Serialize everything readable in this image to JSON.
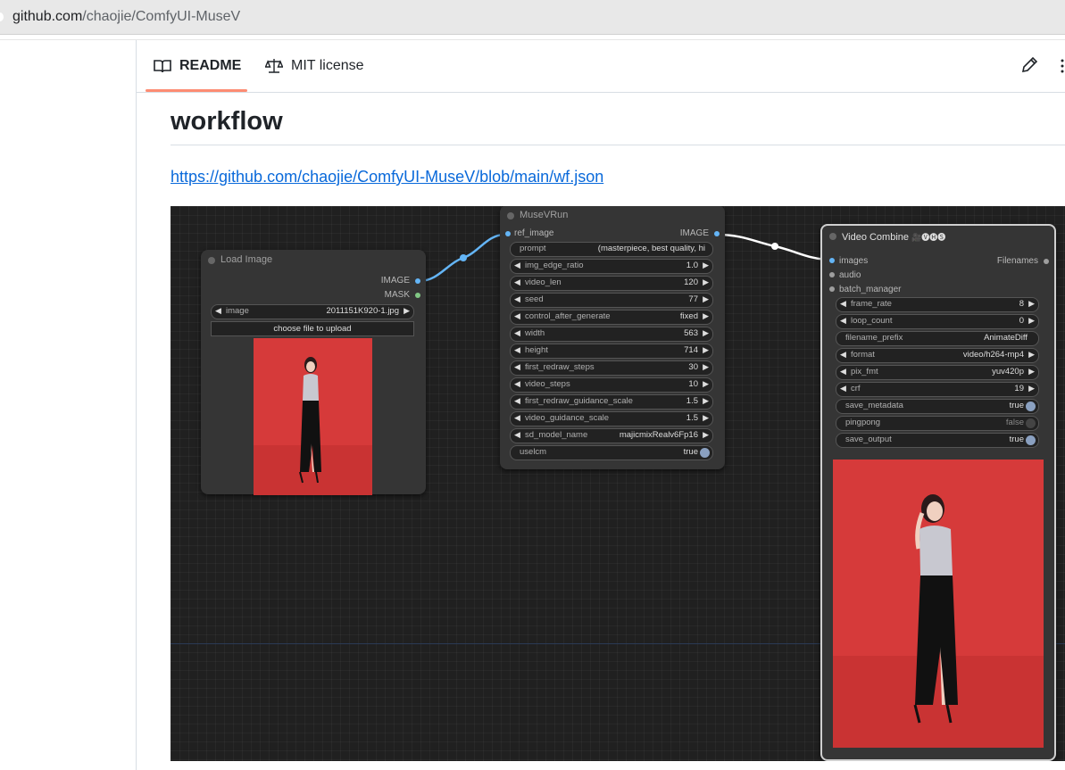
{
  "browser": {
    "url_host": "github.com",
    "url_path": "/chaojie/ComfyUI-MuseV"
  },
  "tabs": {
    "readme": "README",
    "license": "MIT license"
  },
  "readme": {
    "heading": "workflow",
    "link": "https://github.com/chaojie/ComfyUI-MuseV/blob/main/wf.json"
  },
  "load_image": {
    "title": "Load Image",
    "out_image": "IMAGE",
    "out_mask": "MASK",
    "image_label": "image",
    "image_value": "2011151K920-1.jpg",
    "upload_label": "choose file to upload"
  },
  "musev": {
    "title": "MuseVRun",
    "in_ref": "ref_image",
    "out_image": "IMAGE",
    "widgets": [
      {
        "label": "prompt",
        "value": "(masterpiece, best quality, hi"
      },
      {
        "label": "img_edge_ratio",
        "value": "1.0"
      },
      {
        "label": "video_len",
        "value": "120"
      },
      {
        "label": "seed",
        "value": "77"
      },
      {
        "label": "control_after_generate",
        "value": "fixed"
      },
      {
        "label": "width",
        "value": "563"
      },
      {
        "label": "height",
        "value": "714"
      },
      {
        "label": "first_redraw_steps",
        "value": "30"
      },
      {
        "label": "video_steps",
        "value": "10"
      },
      {
        "label": "first_redraw_guidance_scale",
        "value": "1.5"
      },
      {
        "label": "video_guidance_scale",
        "value": "1.5"
      },
      {
        "label": "sd_model_name",
        "value": "majicmixRealv6Fp16"
      },
      {
        "label": "uselcm",
        "value": "true"
      }
    ]
  },
  "video_combine": {
    "title": "Video Combine",
    "title_emoji": "🎥🅥🅗🅢",
    "in_images": "images",
    "in_audio": "audio",
    "in_batch": "batch_manager",
    "out_filenames": "Filenames",
    "widgets": [
      {
        "label": "frame_rate",
        "value": "8"
      },
      {
        "label": "loop_count",
        "value": "0"
      },
      {
        "label": "filename_prefix",
        "value": "AnimateDiff"
      },
      {
        "label": "format",
        "value": "video/h264-mp4"
      },
      {
        "label": "pix_fmt",
        "value": "yuv420p"
      },
      {
        "label": "crf",
        "value": "19"
      },
      {
        "label": "save_metadata",
        "value": "true"
      },
      {
        "label": "pingpong",
        "value": "false"
      },
      {
        "label": "save_output",
        "value": "true"
      }
    ]
  },
  "colors": {
    "link": "#0969da",
    "tab_underline": "#fd8c73",
    "port_image": "#64b5f6",
    "port_mask": "#81c784",
    "canvas": "#202020",
    "photo_bg": "#d63a3a"
  },
  "icons": {
    "readme": "book-icon",
    "license": "scale-icon",
    "edit": "pencil-icon",
    "more": "kebab-icon"
  }
}
